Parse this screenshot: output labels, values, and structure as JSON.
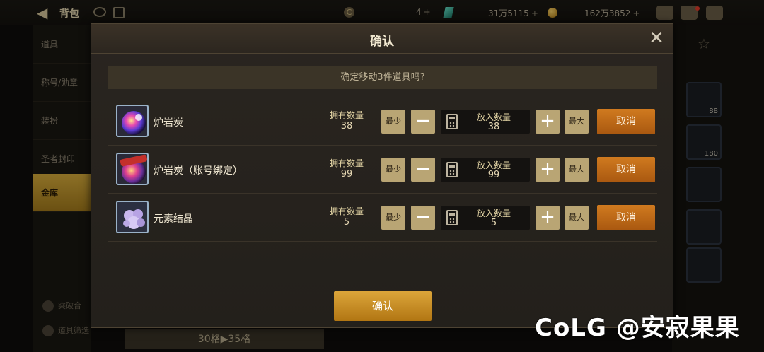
{
  "topbar": {
    "title": "背包",
    "currency_c_glyph": "C",
    "currency_c": "4",
    "currency_gem": "31万5115",
    "currency_gold": "162万3852",
    "plus": "+"
  },
  "sidebar": {
    "items": [
      {
        "label": "道具"
      },
      {
        "label": "称号/勋章"
      },
      {
        "label": "装扮"
      },
      {
        "label": "圣者封印"
      },
      {
        "label": "金库"
      }
    ],
    "bottom": [
      "突破合",
      "道具筛选"
    ]
  },
  "capacity": "30格▶35格",
  "right_slots": [
    {
      "num": ""
    },
    {
      "num": "88"
    },
    {
      "num": "180"
    },
    {
      "num": ""
    },
    {
      "num": ""
    },
    {
      "num": ""
    }
  ],
  "modal": {
    "title": "确认",
    "close": "✕",
    "question": "确定移动3件道具吗?",
    "rows": [
      {
        "name": "炉岩炭",
        "own_label": "拥有数量",
        "own": "38",
        "min_label": "最少",
        "minus": "−",
        "qty_label": "放入数量",
        "qty": "38",
        "plus": "+",
        "max_label": "最大",
        "cancel_label": "取消"
      },
      {
        "name": "炉岩炭（账号绑定）",
        "own_label": "拥有数量",
        "own": "99",
        "min_label": "最少",
        "minus": "−",
        "qty_label": "放入数量",
        "qty": "99",
        "plus": "+",
        "max_label": "最大",
        "cancel_label": "取消"
      },
      {
        "name": "元素结晶",
        "own_label": "拥有数量",
        "own": "5",
        "min_label": "最少",
        "minus": "−",
        "qty_label": "放入数量",
        "qty": "5",
        "plus": "+",
        "max_label": "最大",
        "cancel_label": "取消"
      }
    ],
    "confirm_label": "确认"
  },
  "watermark": "CoLG @安寂果果",
  "colors": {
    "accent_gold": "#dca53a",
    "cancel_orange": "#c06b18",
    "stepper": "#b9a574"
  }
}
